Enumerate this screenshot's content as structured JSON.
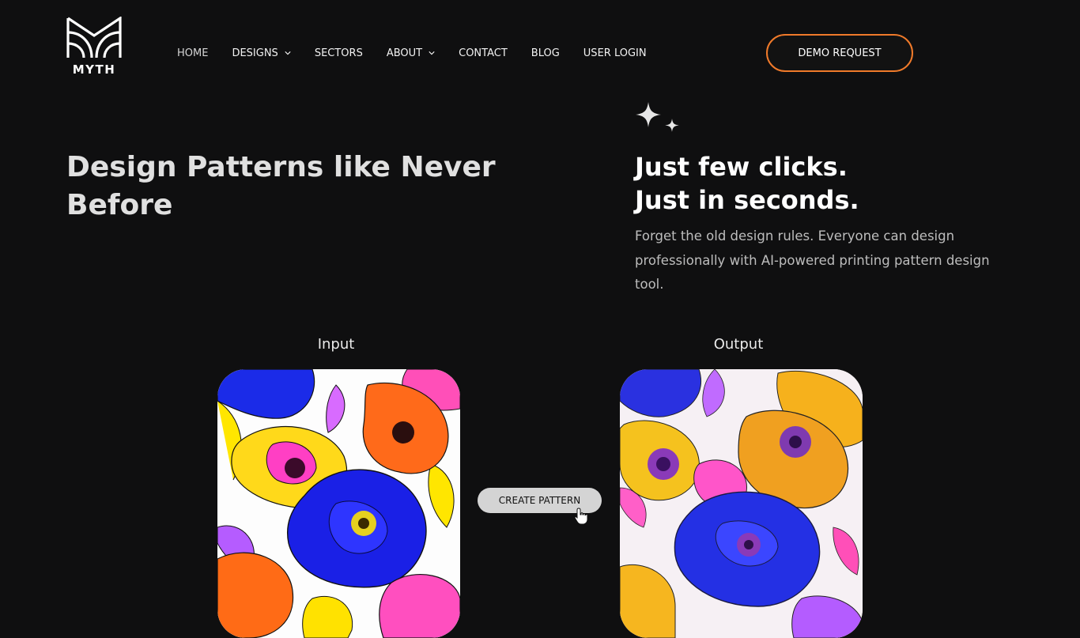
{
  "brand": {
    "name": "MYTH"
  },
  "nav": {
    "items": [
      {
        "label": "HOME",
        "has_dropdown": false
      },
      {
        "label": "DESIGNS",
        "has_dropdown": true
      },
      {
        "label": "SECTORS",
        "has_dropdown": false
      },
      {
        "label": "ABOUT",
        "has_dropdown": true
      },
      {
        "label": "CONTACT",
        "has_dropdown": false
      },
      {
        "label": "BLOG",
        "has_dropdown": false
      },
      {
        "label": "USER LOGIN",
        "has_dropdown": false
      }
    ],
    "cta_label": "DEMO REQUEST"
  },
  "hero": {
    "title": "Design Patterns like Never Before",
    "tagline_line1": "Just few clicks.",
    "tagline_line2": "Just in seconds.",
    "description": "Forget the old design rules. Everyone can design professionally with AI-powered printing pattern design tool."
  },
  "demo": {
    "input_label": "Input",
    "output_label": "Output",
    "button_label": "CREATE PATTERN"
  },
  "icons": {
    "sparkle": "sparkles-icon",
    "dropdown": "chevron-down-icon",
    "cursor": "hand-pointer-icon"
  },
  "colors": {
    "background": "#0f0f10",
    "accent": "#f07a2a"
  }
}
